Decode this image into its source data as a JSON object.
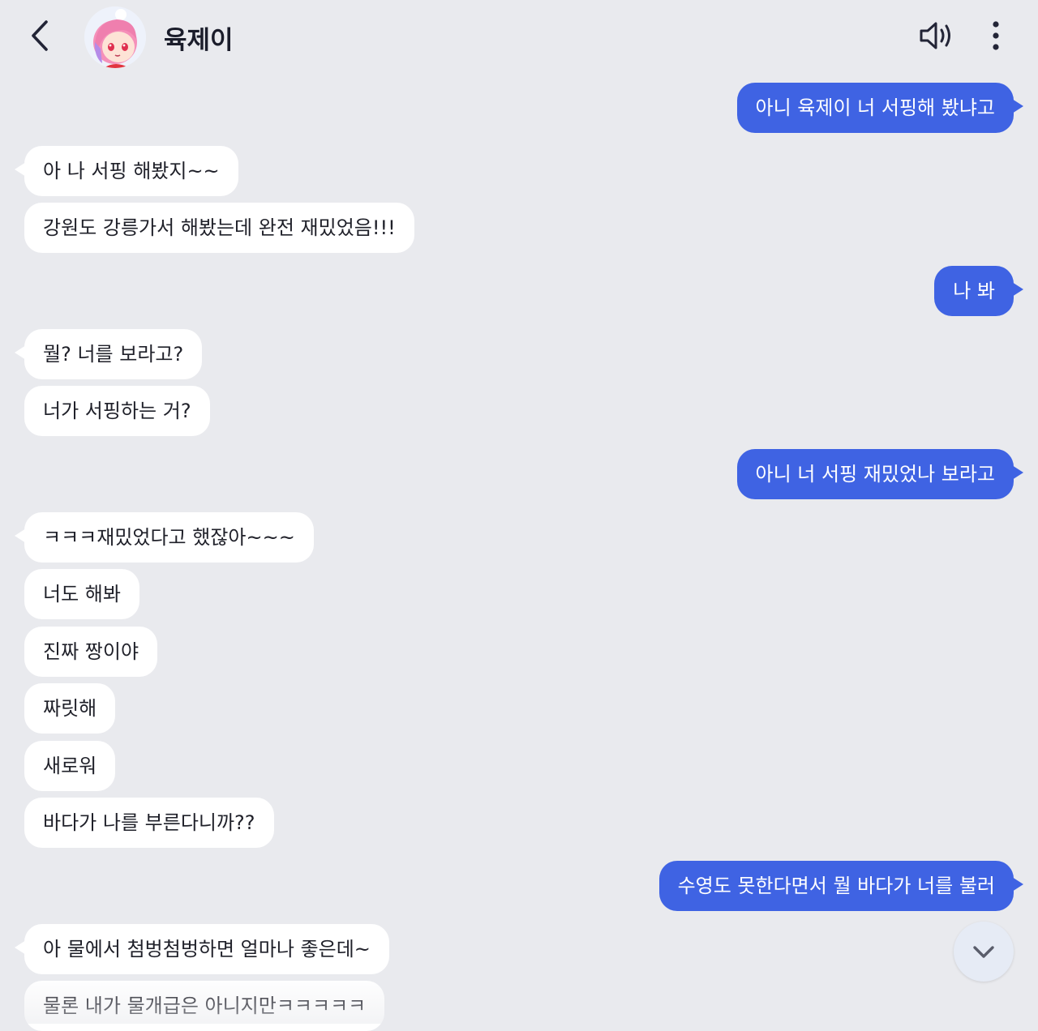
{
  "header": {
    "title": "육제이",
    "back_icon": "chevron-left-icon",
    "sound_icon": "speaker-icon",
    "more_icon": "more-vertical-icon"
  },
  "messages": [
    {
      "side": "out",
      "text": "아니 육제이 너 서핑해 봤냐고"
    },
    {
      "side": "in",
      "text": "아 나 서핑 해봤지~~"
    },
    {
      "side": "in",
      "text": "강원도 강릉가서 해봤는데 완전 재밌었음!!!"
    },
    {
      "side": "out",
      "text": "나 봐"
    },
    {
      "side": "in",
      "text": "뭘? 너를 보라고?"
    },
    {
      "side": "in",
      "text": "너가 서핑하는 거?"
    },
    {
      "side": "out",
      "text": "아니 너 서핑 재밌었나 보라고"
    },
    {
      "side": "in",
      "text": "ㅋㅋㅋ재밌었다고 했잖아~~~"
    },
    {
      "side": "in",
      "text": "너도 해봐"
    },
    {
      "side": "in",
      "text": "진짜 짱이야"
    },
    {
      "side": "in",
      "text": "짜릿해"
    },
    {
      "side": "in",
      "text": "새로워"
    },
    {
      "side": "in",
      "text": "바다가 나를 부른다니까??"
    },
    {
      "side": "out",
      "text": "수영도 못한다면서 뭘 바다가 너를 불러"
    },
    {
      "side": "in",
      "text": "아 물에서 첨벙첨벙하면 얼마나 좋은데~"
    },
    {
      "side": "in",
      "text": "물론 내가 물개급은 아니지만ㅋㅋㅋㅋㅋ"
    }
  ],
  "scroll_down_icon": "chevron-down-icon",
  "colors": {
    "background": "#e9eaee",
    "outgoing_bubble": "#3f63e3",
    "incoming_bubble": "#ffffff"
  }
}
